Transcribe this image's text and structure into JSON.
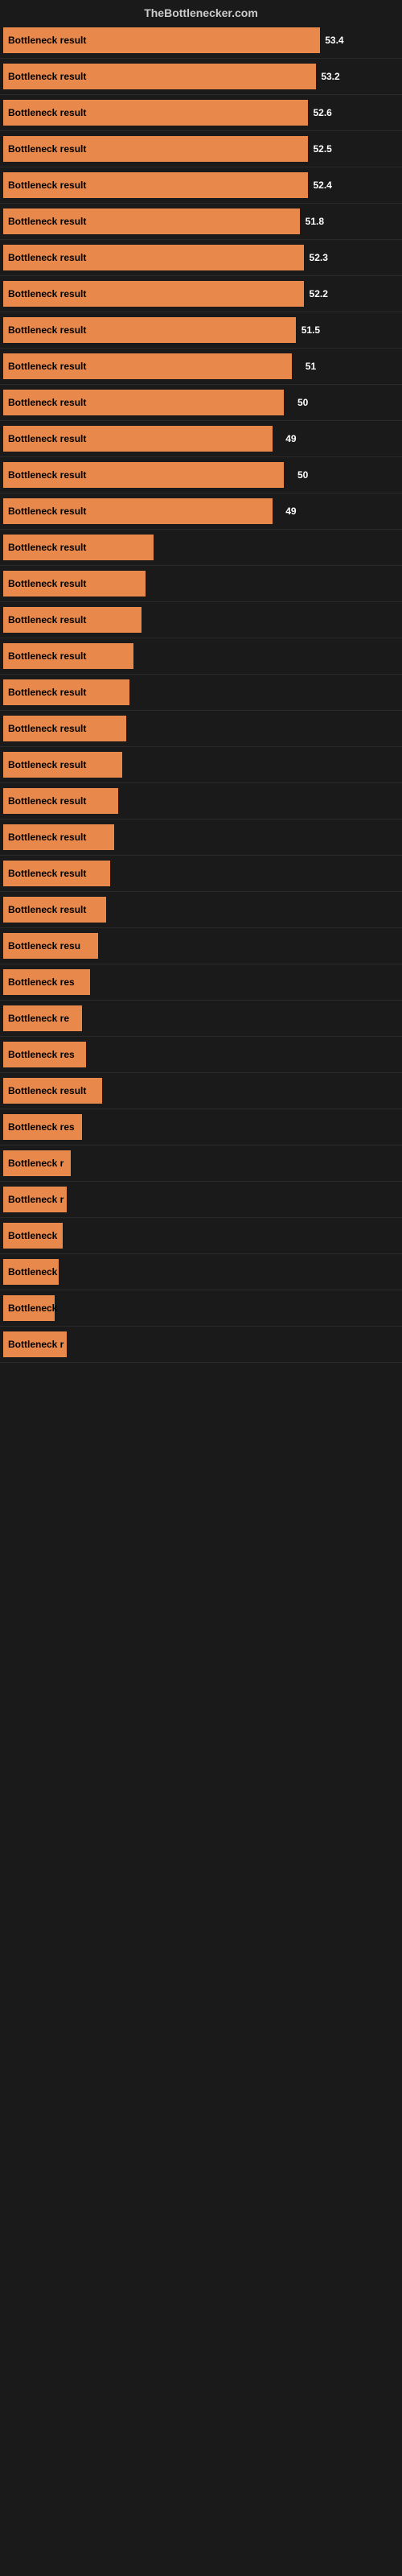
{
  "header": {
    "title": "TheBottlenecker.com"
  },
  "bars": [
    {
      "label": "Bottleneck result",
      "value": "53.4",
      "width_pct": 80
    },
    {
      "label": "Bottleneck result",
      "value": "53.2",
      "width_pct": 79
    },
    {
      "label": "Bottleneck result",
      "value": "52.6",
      "width_pct": 77
    },
    {
      "label": "Bottleneck result",
      "value": "52.5",
      "width_pct": 77
    },
    {
      "label": "Bottleneck result",
      "value": "52.4",
      "width_pct": 77
    },
    {
      "label": "Bottleneck result",
      "value": "51.8",
      "width_pct": 75
    },
    {
      "label": "Bottleneck result",
      "value": "52.3",
      "width_pct": 76
    },
    {
      "label": "Bottleneck result",
      "value": "52.2",
      "width_pct": 76
    },
    {
      "label": "Bottleneck result",
      "value": "51.5",
      "width_pct": 74
    },
    {
      "label": "Bottleneck result",
      "value": "51",
      "width_pct": 73
    },
    {
      "label": "Bottleneck result",
      "value": "50",
      "width_pct": 71
    },
    {
      "label": "Bottleneck result",
      "value": "49",
      "width_pct": 68
    },
    {
      "label": "Bottleneck result",
      "value": "50",
      "width_pct": 71
    },
    {
      "label": "Bottleneck result",
      "value": "49",
      "width_pct": 68
    },
    {
      "label": "Bottleneck result",
      "value": "",
      "width_pct": 38
    },
    {
      "label": "Bottleneck result",
      "value": "",
      "width_pct": 36
    },
    {
      "label": "Bottleneck result",
      "value": "",
      "width_pct": 35
    },
    {
      "label": "Bottleneck result",
      "value": "",
      "width_pct": 33
    },
    {
      "label": "Bottleneck result",
      "value": "",
      "width_pct": 32
    },
    {
      "label": "Bottleneck result",
      "value": "",
      "width_pct": 31
    },
    {
      "label": "Bottleneck result",
      "value": "",
      "width_pct": 30
    },
    {
      "label": "Bottleneck result",
      "value": "",
      "width_pct": 29
    },
    {
      "label": "Bottleneck result",
      "value": "",
      "width_pct": 28
    },
    {
      "label": "Bottleneck result",
      "value": "",
      "width_pct": 27
    },
    {
      "label": "Bottleneck result",
      "value": "",
      "width_pct": 26
    },
    {
      "label": "Bottleneck resu",
      "value": "",
      "width_pct": 24
    },
    {
      "label": "Bottleneck res",
      "value": "",
      "width_pct": 22
    },
    {
      "label": "Bottleneck re",
      "value": "",
      "width_pct": 20
    },
    {
      "label": "Bottleneck res",
      "value": "",
      "width_pct": 21
    },
    {
      "label": "Bottleneck result",
      "value": "",
      "width_pct": 25
    },
    {
      "label": "Bottleneck res",
      "value": "",
      "width_pct": 20
    },
    {
      "label": "Bottleneck r",
      "value": "",
      "width_pct": 17
    },
    {
      "label": "Bottleneck r",
      "value": "",
      "width_pct": 16
    },
    {
      "label": "Bottleneck",
      "value": "",
      "width_pct": 15
    },
    {
      "label": "Bottleneck",
      "value": "",
      "width_pct": 14
    },
    {
      "label": "Bottleneck",
      "value": "",
      "width_pct": 13
    },
    {
      "label": "Bottleneck r",
      "value": "",
      "width_pct": 16
    }
  ],
  "colors": {
    "bar": "#e8884a",
    "background": "#1a1a1a",
    "header_text": "#cccccc",
    "bar_label": "#000000",
    "value_text": "#ffffff"
  }
}
